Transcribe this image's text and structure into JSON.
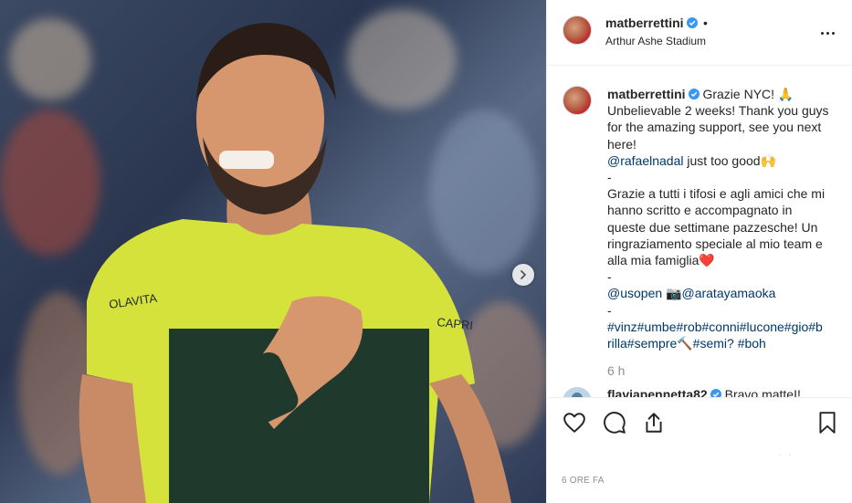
{
  "post": {
    "username": "matberretti­ni",
    "location": "Arthur Ashe Stadium",
    "header_separator": "•"
  },
  "caption": {
    "username": "matberrettini",
    "lines": [
      "Grazie NYC! 🙏",
      "Unbelievable 2 weeks! Thank you guys",
      "for the amazing support, see you next",
      "here!",
      "just too good🙌",
      "-",
      "Grazie a tutti i tifosi e agli amici che mi",
      "hanno scritto e accompagnato in",
      "queste due settimane pazzesche! Un",
      "ringraziamento speciale al mio team e",
      "alla mia famiglia❤️",
      "-",
      "📷",
      "-",
      "#vinz#umbe#rob#conni#lucone#gio#b",
      "rilla#sempre🔨#semi? #boh"
    ],
    "mentions": {
      "rafaelnadal": "@rafaelnadal",
      "usopen": "@usopen",
      "arataya": "@aratayamaoka"
    },
    "relative_time": "6 h"
  },
  "next_comment": {
    "username": "flaviapennetta82",
    "text": "Bravo matteI!"
  },
  "actions": {
    "like": "heart-icon",
    "comment": "comment-icon",
    "share": "share-icon",
    "save": "bookmark-icon"
  },
  "likes_hint": "˙ ˙",
  "timestamp": "6 ORE FA"
}
